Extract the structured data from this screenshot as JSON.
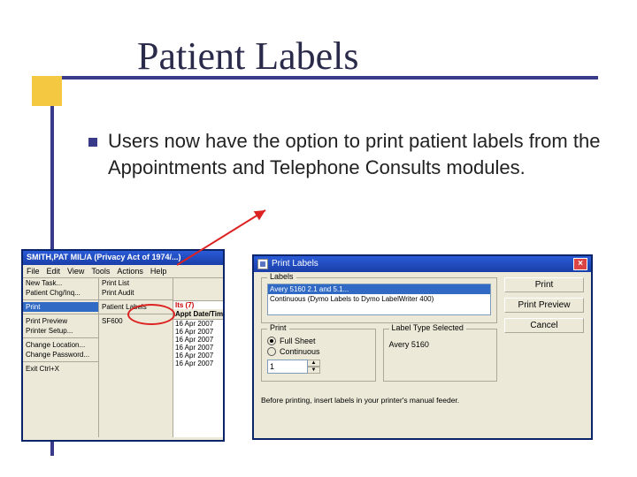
{
  "slide": {
    "title": "Patient Labels",
    "bullet_text": "Users now have the option to print patient labels from the Appointments and Telephone Consults modules."
  },
  "app_window": {
    "title": "SMITH,PAT MIL/A  (Privacy Act of 1974/...)",
    "menu": [
      "File",
      "Edit",
      "View",
      "Tools",
      "Actions",
      "Help"
    ],
    "col1": {
      "items": [
        "New Task...",
        "Patient Chg/Inq...",
        "Print",
        "Print Preview",
        "Printer Setup...",
        "Change Location...",
        "Change Password..."
      ],
      "highlighted": "Print",
      "exit": "Exit    Ctrl+X"
    },
    "col2": {
      "items": [
        "Print List",
        "Print Audit",
        "Patient Labels",
        "SF600"
      ]
    },
    "col3": {
      "header": "Appt Date/Time",
      "results_label": "lts (7)",
      "rows": [
        "16 Apr 2007",
        "16 Apr 2007",
        "16 Apr 2007",
        "16 Apr 2007",
        "16 Apr 2007",
        "16 Apr 2007"
      ]
    }
  },
  "dialog": {
    "title": "Print Labels",
    "labels_group": "Labels",
    "listbox": {
      "selected": "Avery 5160 2.1 and 5.1...",
      "other": "Continuous (Dymo Labels to Dymo LabelWriter 400)"
    },
    "buttons": {
      "print": "Print",
      "preview": "Print Preview",
      "cancel": "Cancel"
    },
    "print_group": {
      "label": "Print",
      "full_sheet": "Full Sheet",
      "continuous": "Continuous",
      "count": "1"
    },
    "type_group": {
      "label": "Label Type Selected",
      "value": "Avery 5160"
    },
    "footnote": "Before printing, insert labels in your printer's manual feeder."
  }
}
